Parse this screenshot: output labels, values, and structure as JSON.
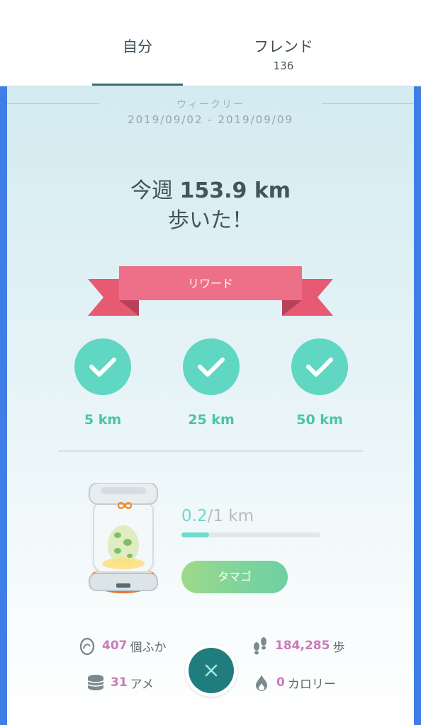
{
  "tabs": [
    {
      "label": "自分",
      "count": ""
    },
    {
      "label": "フレンド",
      "count": "136"
    }
  ],
  "weekly": {
    "label": "ウィークリー",
    "range": "2019/09/02 - 2019/09/09",
    "headline_prefix": "今週 ",
    "distance": "153.9 km",
    "headline_line2": "歩いた！"
  },
  "rewards": {
    "banner": "リワード",
    "tiers": [
      {
        "label": "5 km",
        "achieved": true
      },
      {
        "label": "25 km",
        "achieved": true
      },
      {
        "label": "50 km",
        "achieved": true
      }
    ]
  },
  "egg": {
    "progress_done": "0.2",
    "progress_rest": "/1 km",
    "progress_fraction": 0.2,
    "button": "タマゴ"
  },
  "stats": {
    "hatched_num": "407",
    "hatched_unit": "個ふか",
    "candy_num": "31",
    "candy_unit": "アメ",
    "steps_num": "184,285",
    "steps_unit": "歩",
    "calories_num": "0",
    "calories_unit": "カロリー"
  },
  "colors": {
    "accent_teal": "#5fd7c2",
    "ribbon_pink": "#ee6f86",
    "stat_pink": "#cc79b9",
    "side_blue": "#3f7ee7",
    "close_dark": "#1f7e7d"
  },
  "icons": [
    "check-icon",
    "egg-icon",
    "candy-icon",
    "footsteps-icon",
    "flame-icon",
    "close-icon",
    "infinity-icon"
  ]
}
